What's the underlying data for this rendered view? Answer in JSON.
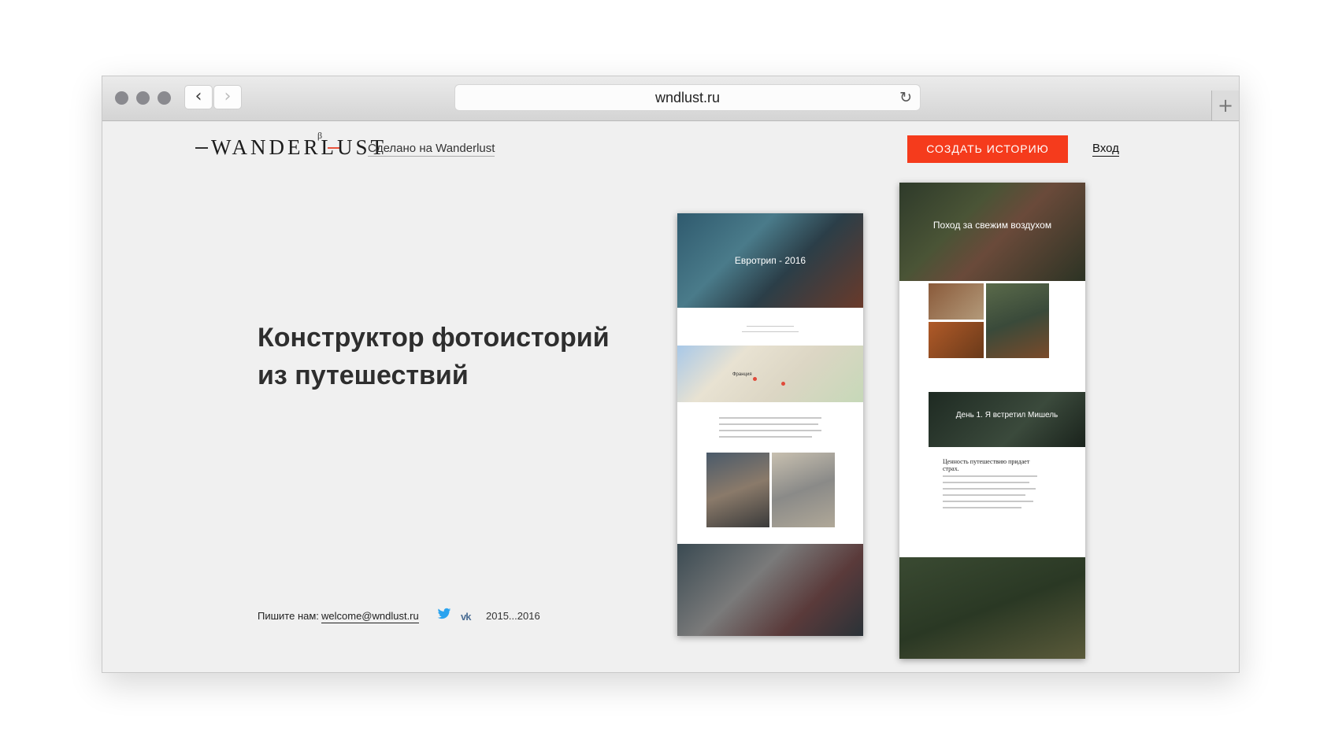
{
  "browser": {
    "url": "wndlust.ru",
    "reload_icon": "reload-icon",
    "back_icon": "chevron-left-icon",
    "forward_icon": "chevron-right-icon",
    "new_tab_icon": "plus-icon"
  },
  "header": {
    "logo_text": "WANDERLUST",
    "logo_beta": "β",
    "made_link": "Сделано на Wanderlust",
    "create_button": "СОЗДАТЬ ИСТОРИЮ",
    "login_link": "Вход",
    "accent_color": "#f53b1c"
  },
  "hero": {
    "title_line1": "Конструктор фотоисторий",
    "title_line2": "из путешествий"
  },
  "footer": {
    "write_us": "Пишите нам:",
    "email": "welcome@wndlust.ru",
    "twitter_icon": "twitter-icon",
    "vk_icon": "vk-icon",
    "years": "2015...2016"
  },
  "preview": {
    "left_story_title": "Евротрип - 2016",
    "map_label": "Франция",
    "right_story_title": "Поход за свежим воздухом",
    "right_day_title": "День 1. Я встретил Мишель",
    "right_quote": "Ценность путешествию придает страх."
  }
}
